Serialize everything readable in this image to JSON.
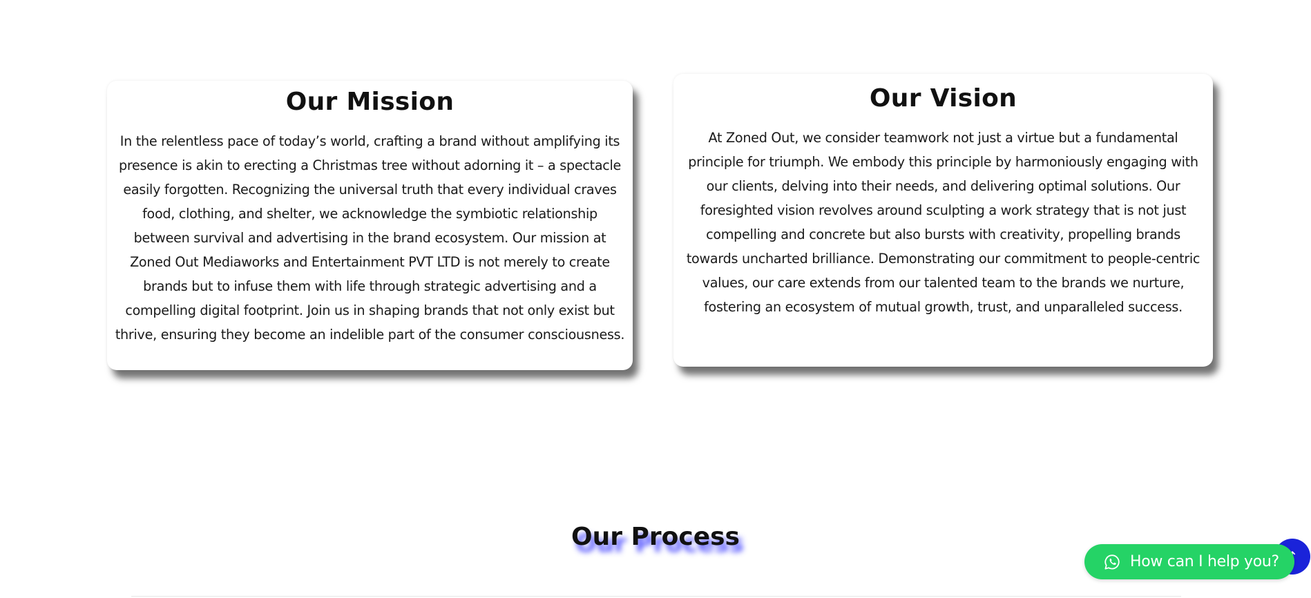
{
  "mission": {
    "title": "Our Mission",
    "text": "In the relentless pace of today’s world, crafting a brand without amplifying its presence is akin to erecting a Christmas tree without adorning it – a spectacle easily forgotten. Recognizing the universal truth that every individual craves food, clothing, and shelter, we acknowledge the symbiotic relationship between survival and advertising in the brand ecosystem. Our mission at Zoned Out Mediaworks and Entertainment PVT LTD is not merely to create brands but to infuse them with life through strategic advertising and a compelling digital footprint. Join us in shaping brands that not only exist but thrive, ensuring they become an indelible part of the consumer consciousness."
  },
  "vision": {
    "title": "Our Vision",
    "text": "At Zoned Out, we consider teamwork not just a virtue but a fundamental principle for triumph. We embody this principle by harmoniously engaging with our clients, delving into their needs, and delivering optimal solutions. Our foresighted vision revolves around sculpting a work strategy that is not just compelling and concrete but also bursts with creativity, propelling brands towards uncharted brilliance. Demonstrating our commitment to people-centric values, our care extends from our talented team to the brands we nurture, fostering an ecosystem of mutual growth, trust, and unparalleled success."
  },
  "process": {
    "title": "Our Process"
  },
  "chat_widget": {
    "label": "How can I help you?",
    "icon": "whatsapp-icon",
    "color": "#25d366"
  },
  "scroll_top": {
    "icon": "arrow-up-icon",
    "color": "#1a23d9"
  },
  "colors": {
    "process_title_shadow": "#3c3cff"
  }
}
